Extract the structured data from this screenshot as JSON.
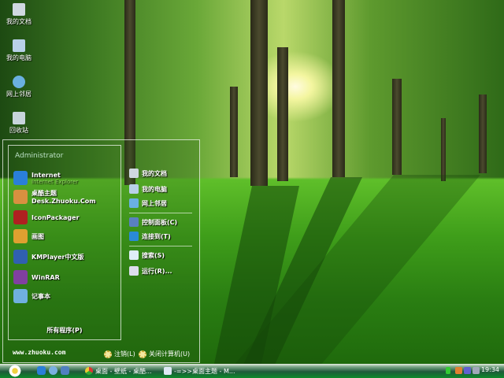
{
  "desktop": {
    "icons": [
      {
        "label": "我的文档",
        "icon": "my-documents-icon"
      },
      {
        "label": "我的电脑",
        "icon": "my-computer-icon"
      },
      {
        "label": "网上邻居",
        "icon": "network-places-icon"
      },
      {
        "label": "回收站",
        "icon": "recycle-bin-icon"
      }
    ]
  },
  "start_menu": {
    "user": "Administrator",
    "programs": [
      {
        "label": "Internet",
        "sub": "Internet Explorer",
        "icon": "internet-explorer-icon",
        "color": "#2a7fd8"
      },
      {
        "label": "桌酷主题Desk.Zhuoku.Com",
        "icon": "zhuoku-icon",
        "color": "#d89040"
      },
      {
        "label": "IconPackager",
        "icon": "iconpackager-icon",
        "color": "#b02020"
      },
      {
        "label": "画图",
        "icon": "paint-icon",
        "color": "#e0a030"
      },
      {
        "label": "KMPlayer中文版",
        "icon": "kmplayer-icon",
        "color": "#3060b0"
      },
      {
        "label": "WinRAR",
        "icon": "winrar-icon",
        "color": "#8040a0"
      },
      {
        "label": "记事本",
        "icon": "notepad-icon",
        "color": "#70b0e0"
      }
    ],
    "all_programs": "所有程序(P)",
    "places": [
      {
        "label": "我的文档",
        "icon": "my-documents-icon"
      },
      {
        "label": "我的电脑",
        "icon": "my-computer-icon"
      },
      {
        "label": "网上邻居",
        "icon": "network-places-icon"
      },
      {
        "label": "控制面板(C)",
        "icon": "control-panel-icon"
      },
      {
        "label": "连接到(T)",
        "icon": "connect-to-icon"
      },
      {
        "label": "搜索(S)",
        "icon": "search-icon"
      },
      {
        "label": "运行(R)...",
        "icon": "run-icon"
      }
    ],
    "website": "www.zhuoku.com",
    "logoff": "注销(L)",
    "shutdown": "关闭计算机(U)"
  },
  "taskbar": {
    "tasks": [
      {
        "label": "桌面 - 壁纸 - 桌酷...",
        "icon": "chrome-icon"
      },
      {
        "label": "-=>>桌面主题 - M...",
        "icon": "document-icon"
      }
    ],
    "clock": "19:34"
  }
}
